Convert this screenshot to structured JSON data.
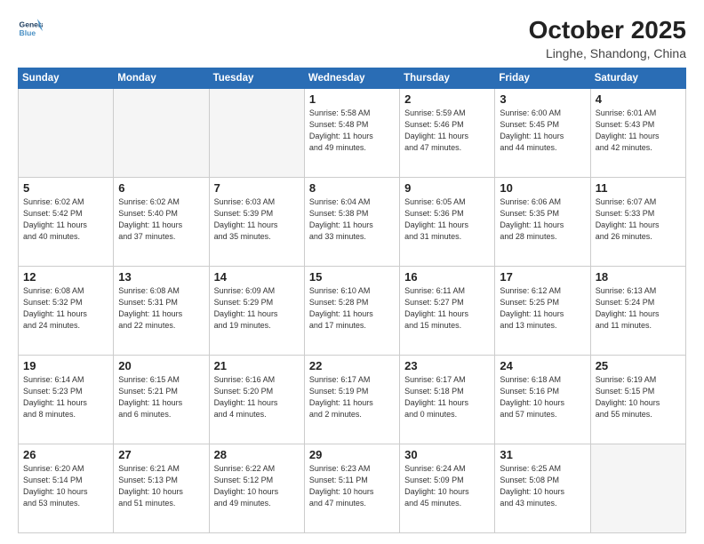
{
  "header": {
    "logo_line1": "General",
    "logo_line2": "Blue",
    "title": "October 2025",
    "subtitle": "Linghe, Shandong, China"
  },
  "weekdays": [
    "Sunday",
    "Monday",
    "Tuesday",
    "Wednesday",
    "Thursday",
    "Friday",
    "Saturday"
  ],
  "weeks": [
    [
      {
        "day": "",
        "info": ""
      },
      {
        "day": "",
        "info": ""
      },
      {
        "day": "",
        "info": ""
      },
      {
        "day": "1",
        "info": "Sunrise: 5:58 AM\nSunset: 5:48 PM\nDaylight: 11 hours\nand 49 minutes."
      },
      {
        "day": "2",
        "info": "Sunrise: 5:59 AM\nSunset: 5:46 PM\nDaylight: 11 hours\nand 47 minutes."
      },
      {
        "day": "3",
        "info": "Sunrise: 6:00 AM\nSunset: 5:45 PM\nDaylight: 11 hours\nand 44 minutes."
      },
      {
        "day": "4",
        "info": "Sunrise: 6:01 AM\nSunset: 5:43 PM\nDaylight: 11 hours\nand 42 minutes."
      }
    ],
    [
      {
        "day": "5",
        "info": "Sunrise: 6:02 AM\nSunset: 5:42 PM\nDaylight: 11 hours\nand 40 minutes."
      },
      {
        "day": "6",
        "info": "Sunrise: 6:02 AM\nSunset: 5:40 PM\nDaylight: 11 hours\nand 37 minutes."
      },
      {
        "day": "7",
        "info": "Sunrise: 6:03 AM\nSunset: 5:39 PM\nDaylight: 11 hours\nand 35 minutes."
      },
      {
        "day": "8",
        "info": "Sunrise: 6:04 AM\nSunset: 5:38 PM\nDaylight: 11 hours\nand 33 minutes."
      },
      {
        "day": "9",
        "info": "Sunrise: 6:05 AM\nSunset: 5:36 PM\nDaylight: 11 hours\nand 31 minutes."
      },
      {
        "day": "10",
        "info": "Sunrise: 6:06 AM\nSunset: 5:35 PM\nDaylight: 11 hours\nand 28 minutes."
      },
      {
        "day": "11",
        "info": "Sunrise: 6:07 AM\nSunset: 5:33 PM\nDaylight: 11 hours\nand 26 minutes."
      }
    ],
    [
      {
        "day": "12",
        "info": "Sunrise: 6:08 AM\nSunset: 5:32 PM\nDaylight: 11 hours\nand 24 minutes."
      },
      {
        "day": "13",
        "info": "Sunrise: 6:08 AM\nSunset: 5:31 PM\nDaylight: 11 hours\nand 22 minutes."
      },
      {
        "day": "14",
        "info": "Sunrise: 6:09 AM\nSunset: 5:29 PM\nDaylight: 11 hours\nand 19 minutes."
      },
      {
        "day": "15",
        "info": "Sunrise: 6:10 AM\nSunset: 5:28 PM\nDaylight: 11 hours\nand 17 minutes."
      },
      {
        "day": "16",
        "info": "Sunrise: 6:11 AM\nSunset: 5:27 PM\nDaylight: 11 hours\nand 15 minutes."
      },
      {
        "day": "17",
        "info": "Sunrise: 6:12 AM\nSunset: 5:25 PM\nDaylight: 11 hours\nand 13 minutes."
      },
      {
        "day": "18",
        "info": "Sunrise: 6:13 AM\nSunset: 5:24 PM\nDaylight: 11 hours\nand 11 minutes."
      }
    ],
    [
      {
        "day": "19",
        "info": "Sunrise: 6:14 AM\nSunset: 5:23 PM\nDaylight: 11 hours\nand 8 minutes."
      },
      {
        "day": "20",
        "info": "Sunrise: 6:15 AM\nSunset: 5:21 PM\nDaylight: 11 hours\nand 6 minutes."
      },
      {
        "day": "21",
        "info": "Sunrise: 6:16 AM\nSunset: 5:20 PM\nDaylight: 11 hours\nand 4 minutes."
      },
      {
        "day": "22",
        "info": "Sunrise: 6:17 AM\nSunset: 5:19 PM\nDaylight: 11 hours\nand 2 minutes."
      },
      {
        "day": "23",
        "info": "Sunrise: 6:17 AM\nSunset: 5:18 PM\nDaylight: 11 hours\nand 0 minutes."
      },
      {
        "day": "24",
        "info": "Sunrise: 6:18 AM\nSunset: 5:16 PM\nDaylight: 10 hours\nand 57 minutes."
      },
      {
        "day": "25",
        "info": "Sunrise: 6:19 AM\nSunset: 5:15 PM\nDaylight: 10 hours\nand 55 minutes."
      }
    ],
    [
      {
        "day": "26",
        "info": "Sunrise: 6:20 AM\nSunset: 5:14 PM\nDaylight: 10 hours\nand 53 minutes."
      },
      {
        "day": "27",
        "info": "Sunrise: 6:21 AM\nSunset: 5:13 PM\nDaylight: 10 hours\nand 51 minutes."
      },
      {
        "day": "28",
        "info": "Sunrise: 6:22 AM\nSunset: 5:12 PM\nDaylight: 10 hours\nand 49 minutes."
      },
      {
        "day": "29",
        "info": "Sunrise: 6:23 AM\nSunset: 5:11 PM\nDaylight: 10 hours\nand 47 minutes."
      },
      {
        "day": "30",
        "info": "Sunrise: 6:24 AM\nSunset: 5:09 PM\nDaylight: 10 hours\nand 45 minutes."
      },
      {
        "day": "31",
        "info": "Sunrise: 6:25 AM\nSunset: 5:08 PM\nDaylight: 10 hours\nand 43 minutes."
      },
      {
        "day": "",
        "info": ""
      }
    ]
  ]
}
